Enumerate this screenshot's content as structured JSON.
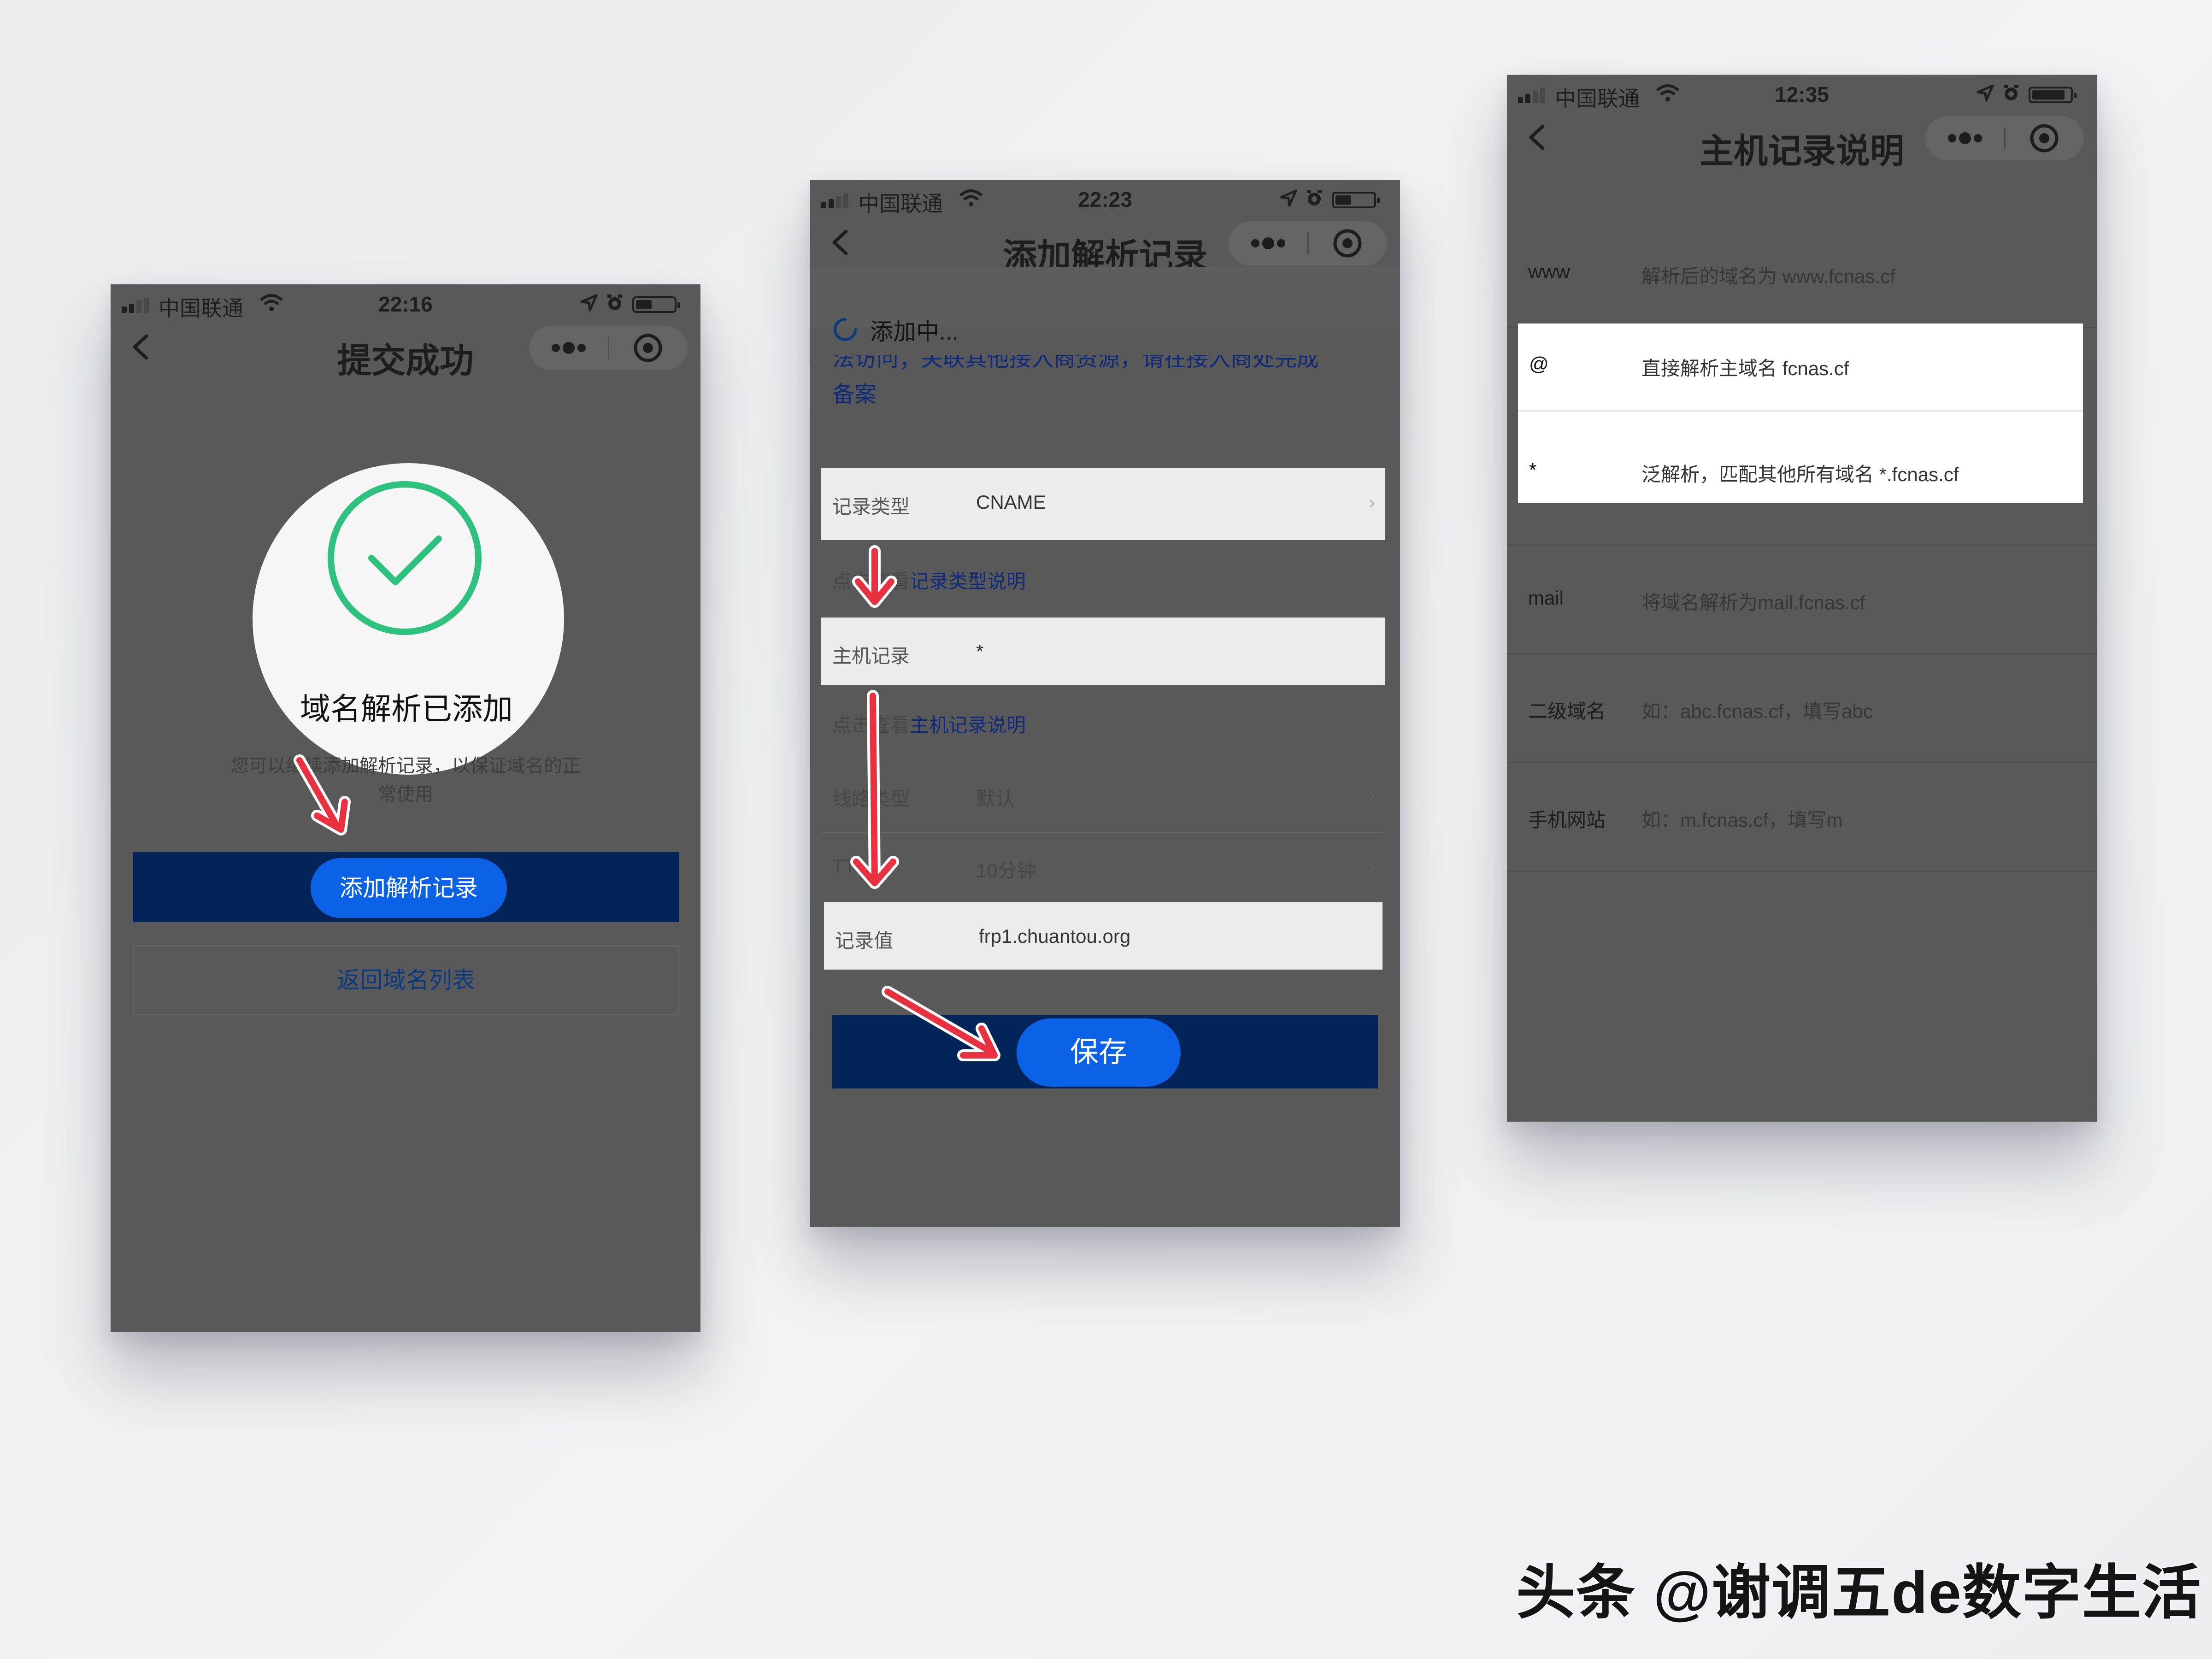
{
  "phone1": {
    "status": {
      "carrier": "中国联通",
      "time": "22:16"
    },
    "nav": {
      "title": "提交成功"
    },
    "success_title": "域名解析已添加",
    "success_desc_line1": "您可以继续添加解析记录，以保证域名的正",
    "success_desc_line2": "常使用",
    "add_record_button": "添加解析记录",
    "back_to_list_button": "返回域名列表"
  },
  "phone2": {
    "status": {
      "carrier": "中国联通",
      "time": "22:23"
    },
    "nav": {
      "title": "添加解析记录"
    },
    "loading_text": "添加中...",
    "notice_line1": "法访问；关联其他接入商资源，请在接入商处完成",
    "notice_line2": "备案",
    "rows": {
      "record_type": {
        "label": "记录类型",
        "value": "CNAME",
        "chevron": "›"
      },
      "host": {
        "label": "主机记录",
        "value": "*"
      },
      "line": {
        "label": "线路类型",
        "value": "默认",
        "chevron": "›"
      },
      "ttl": {
        "label": "TTL",
        "value": "10分钟",
        "chevron": "›"
      },
      "value": {
        "label": "记录值",
        "value": "frp1.chuantou.org"
      }
    },
    "hint1": {
      "prefix": "点击查看",
      "link": "记录类型说明"
    },
    "hint2": {
      "prefix": "点击查看",
      "link": "主机记录说明"
    },
    "save_button": "保存"
  },
  "phone3": {
    "status": {
      "carrier": "中国联通",
      "time": "12:35"
    },
    "nav": {
      "title": "主机记录说明"
    },
    "records": [
      {
        "key": "www",
        "desc": "解析后的域名为 www.fcnas.cf"
      },
      {
        "key": "@",
        "desc": "直接解析主域名 fcnas.cf"
      },
      {
        "key": "*",
        "desc": "泛解析，匹配其他所有域名 *.fcnas.cf"
      },
      {
        "key": "mail",
        "desc": "将域名解析为mail.fcnas.cf"
      },
      {
        "key": "二级域名",
        "desc": "如：abc.fcnas.cf，填写abc"
      },
      {
        "key": "手机网站",
        "desc": "如：m.fcnas.cf，填写m"
      }
    ]
  },
  "watermark": "头条 @谢调五de数字生活",
  "colors": {
    "arrow": "#e8303e",
    "accent": "#0b62e6",
    "bar": "#032458",
    "success": "#2ec27e"
  },
  "icons": [
    "back-icon",
    "more-icon",
    "target-icon",
    "check-icon",
    "spinner-icon",
    "chevron-right-icon",
    "signal-icon",
    "wifi-icon",
    "location-icon",
    "alarm-icon",
    "battery-icon"
  ]
}
